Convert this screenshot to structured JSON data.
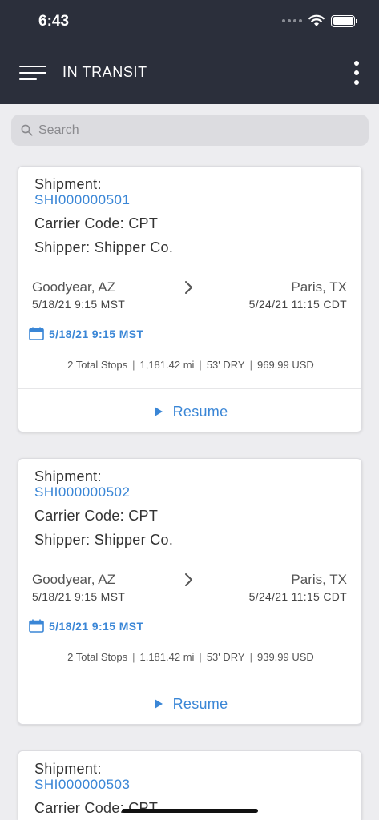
{
  "status_bar": {
    "time": "6:43"
  },
  "header": {
    "title": "IN TRANSIT"
  },
  "search": {
    "placeholder": "Search"
  },
  "labels": {
    "shipment": "Shipment:",
    "carrier_code": "Carrier Code:",
    "shipper": "Shipper:",
    "resume": "Resume"
  },
  "shipments": [
    {
      "id": "SHI000000501",
      "carrier_code": "CPT",
      "shipper": "Shipper Co.",
      "origin": {
        "city": "Goodyear, AZ",
        "datetime": "5/18/21 9:15 MST"
      },
      "destination": {
        "city": "Paris, TX",
        "datetime": "5/24/21 11:15 CDT"
      },
      "appointment": "5/18/21 9:15 MST",
      "stops": "2 Total Stops",
      "distance": "1,181.42 mi",
      "equipment": "53' DRY",
      "amount": "969.99 USD"
    },
    {
      "id": "SHI000000502",
      "carrier_code": "CPT",
      "shipper": "Shipper Co.",
      "origin": {
        "city": "Goodyear, AZ",
        "datetime": "5/18/21 9:15 MST"
      },
      "destination": {
        "city": "Paris, TX",
        "datetime": "5/24/21 11:15 CDT"
      },
      "appointment": "5/18/21 9:15 MST",
      "stops": "2 Total Stops",
      "distance": "1,181.42 mi",
      "equipment": "53' DRY",
      "amount": "939.99 USD"
    },
    {
      "id": "SHI000000503",
      "carrier_code": "CPT"
    }
  ],
  "colors": {
    "header_bg": "#2b2f3b",
    "accent": "#3a86d6",
    "page_bg": "#ededf0"
  },
  "icons": {
    "menu": "hamburger-menu-icon",
    "more": "vertical-more-icon",
    "search": "search-icon",
    "calendar": "calendar-icon",
    "route": "chevron-right-icon",
    "play": "play-icon"
  }
}
